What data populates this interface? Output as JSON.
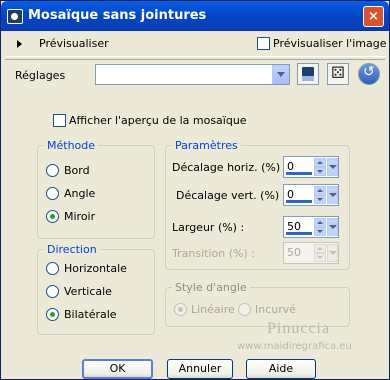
{
  "window": {
    "title": "Mosaïque sans jointures",
    "close_label": "×"
  },
  "preview": {
    "label": "Prévisualiser",
    "image_checkbox_label": "Prévisualiser l'image",
    "image_checked": false
  },
  "reglages": {
    "label": "Réglages",
    "value": ""
  },
  "apercu": {
    "label": "Afficher l'aperçu de la mosaïque",
    "checked": false
  },
  "methode": {
    "title": "Méthode",
    "options": [
      {
        "label": "Bord",
        "selected": false
      },
      {
        "label": "Angle",
        "selected": false
      },
      {
        "label": "Miroir",
        "selected": true
      }
    ]
  },
  "direction": {
    "title": "Direction",
    "options": [
      {
        "label": "Horizontale",
        "selected": false
      },
      {
        "label": "Verticale",
        "selected": false
      },
      {
        "label": "Bilatérale",
        "selected": true
      }
    ]
  },
  "parametres": {
    "title": "Paramètres",
    "fields": [
      {
        "label": "Décalage horiz. (%) :",
        "value": "0",
        "enabled": true
      },
      {
        "label": "Décalage vert. (%) :",
        "value": "0",
        "enabled": true
      },
      {
        "label": "Largeur (%) :",
        "value": "50",
        "enabled": true
      },
      {
        "label": "Transition (%) :",
        "value": "50",
        "enabled": false
      }
    ]
  },
  "style_angle": {
    "title": "Style d'angle",
    "enabled": false,
    "options": [
      {
        "label": "Linéaire",
        "selected": true
      },
      {
        "label": "Incurvé",
        "selected": false
      }
    ]
  },
  "watermark": {
    "name": "Pinuccia",
    "url": "www.maidiregrafica.eu"
  },
  "buttons": {
    "ok": "OK",
    "cancel": "Annuler",
    "help": "Aide"
  },
  "colors": {
    "title_bar": "#0346c6",
    "group_title": "#0046d5",
    "dialog_bg": "#ece9d8"
  }
}
